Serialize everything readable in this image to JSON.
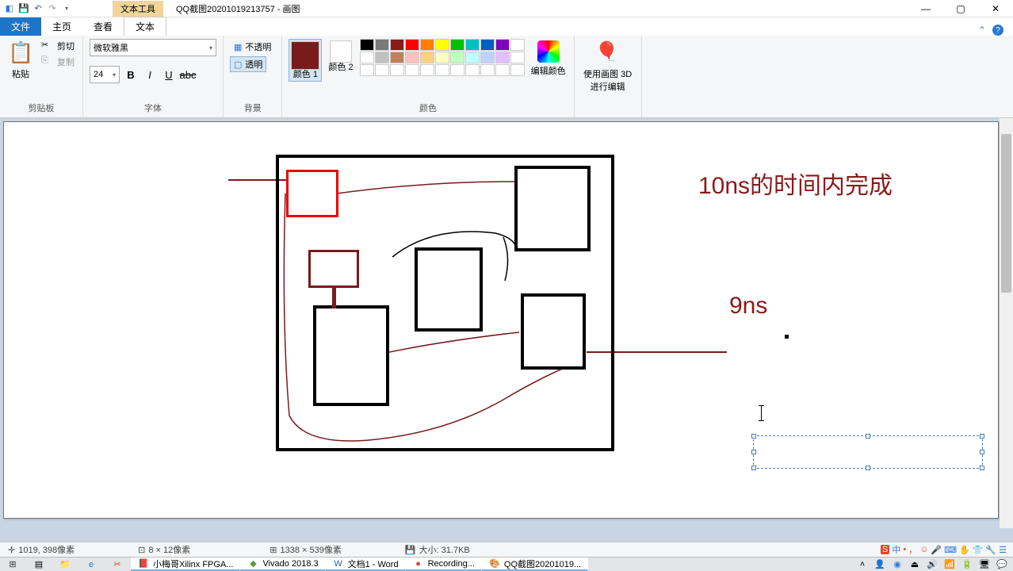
{
  "titlebar": {
    "tool_context": "文本工具",
    "title": "QQ截图20201019213757 - 画图"
  },
  "tabs": {
    "file": "文件",
    "home": "主页",
    "view": "查看",
    "text": "文本"
  },
  "clipboard": {
    "paste": "粘贴",
    "cut": "剪切",
    "copy": "复制",
    "group": "剪贴板"
  },
  "font": {
    "name": "微软雅黑",
    "size": "24",
    "group": "字体"
  },
  "background": {
    "opaque": "不透明",
    "transparent": "透明",
    "group": "背景"
  },
  "colors": {
    "c1": "颜色 1",
    "c2": "颜色 2",
    "edit": "编辑颜色",
    "group": "颜色",
    "color1_hex": "#7a1b1b",
    "color2_hex": "#ffffff",
    "palette": [
      [
        "#000000",
        "#7a7a7a",
        "#8b1a1a",
        "#ff0000",
        "#ff8000",
        "#ffff00",
        "#00c000",
        "#00c0c0",
        "#0060c0",
        "#8000c0",
        "#ffffff"
      ],
      [
        "#ffffff",
        "#c0c0c0",
        "#c08060",
        "#ffc0c0",
        "#ffd080",
        "#ffffc0",
        "#c0ffc0",
        "#c0ffff",
        "#c0d0ff",
        "#e0c0ff",
        "#ffffff"
      ],
      [
        "#ffffff",
        "#ffffff",
        "#ffffff",
        "#ffffff",
        "#ffffff",
        "#ffffff",
        "#ffffff",
        "#ffffff",
        "#ffffff",
        "#ffffff",
        "#ffffff"
      ]
    ]
  },
  "paint3d": {
    "label": "使用画图 3D 进行编辑"
  },
  "canvas": {
    "text1": "10ns的时间内完成",
    "text2": "9ns"
  },
  "status": {
    "coords": "1019, 398像素",
    "sel_size": "8 × 12像素",
    "canvas_size": "1338 × 539像素",
    "file_size": "大小: 31.7KB"
  },
  "ime": {
    "label": "中"
  },
  "taskbar": {
    "items": [
      {
        "label": "小梅哥Xilinx FPGA..."
      },
      {
        "label": "Vivado 2018.3"
      },
      {
        "label": "文档1 - Word"
      },
      {
        "label": "Recording..."
      },
      {
        "label": "QQ截图20201019..."
      }
    ]
  }
}
